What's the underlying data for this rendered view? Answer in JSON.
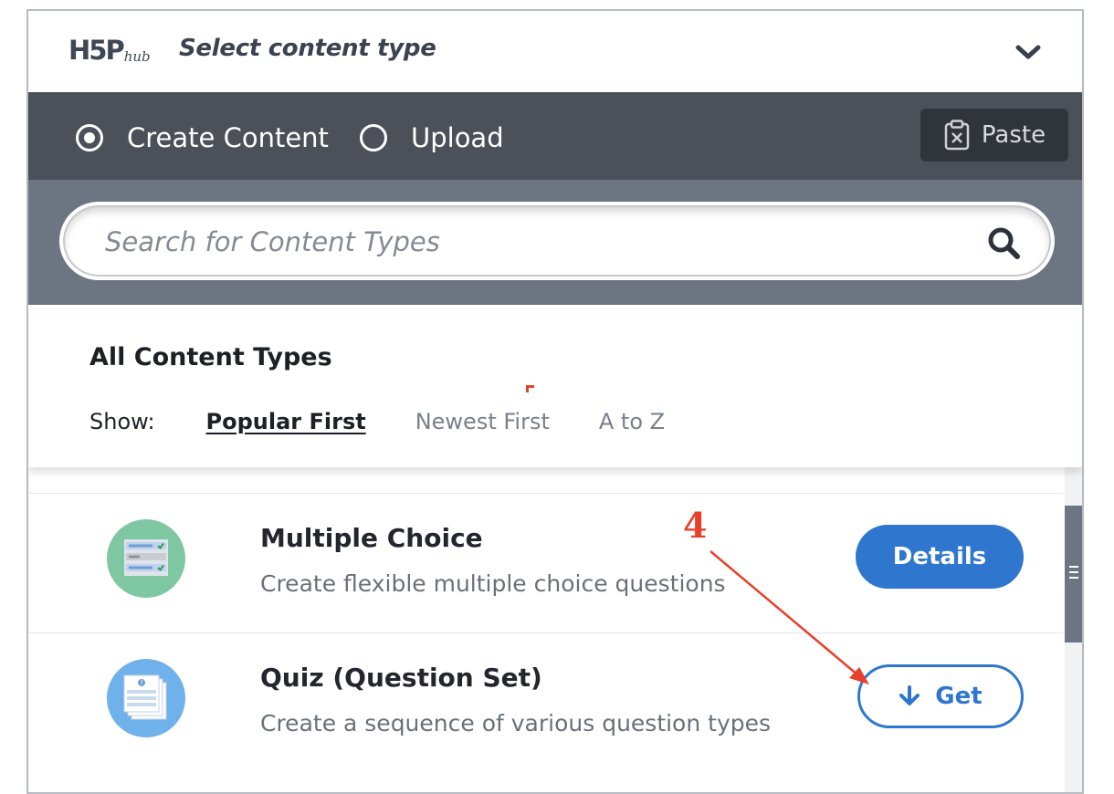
{
  "header": {
    "logo_main": "H5P",
    "logo_sub": "hub",
    "title": "Select content type"
  },
  "tabs": {
    "create_label": "Create Content",
    "upload_label": "Upload",
    "selected": "Create Content",
    "paste_label": "Paste"
  },
  "search": {
    "placeholder": "Search for Content Types"
  },
  "content_types": {
    "title": "All Content Types",
    "show_label": "Show:",
    "sort_options": [
      "Popular First",
      "Newest First",
      "A to Z"
    ],
    "active_sort": "Popular First"
  },
  "list": [
    {
      "title": "Multiple Choice",
      "description": "Create flexible multiple choice questions",
      "button": "Details",
      "icon": "multiple-choice-icon",
      "icon_color": "#7fc7a3"
    },
    {
      "title": "Quiz (Question Set)",
      "description": "Create a sequence of various question types",
      "button": "Get",
      "icon": "question-set-icon",
      "icon_color": "#6fb1ea"
    }
  ],
  "annotation": {
    "step_number": "4",
    "color": "#e8402a"
  },
  "colors": {
    "accent_blue": "#2f76cf",
    "tabbar": "#4b5059",
    "searchbar": "#6d7583"
  }
}
